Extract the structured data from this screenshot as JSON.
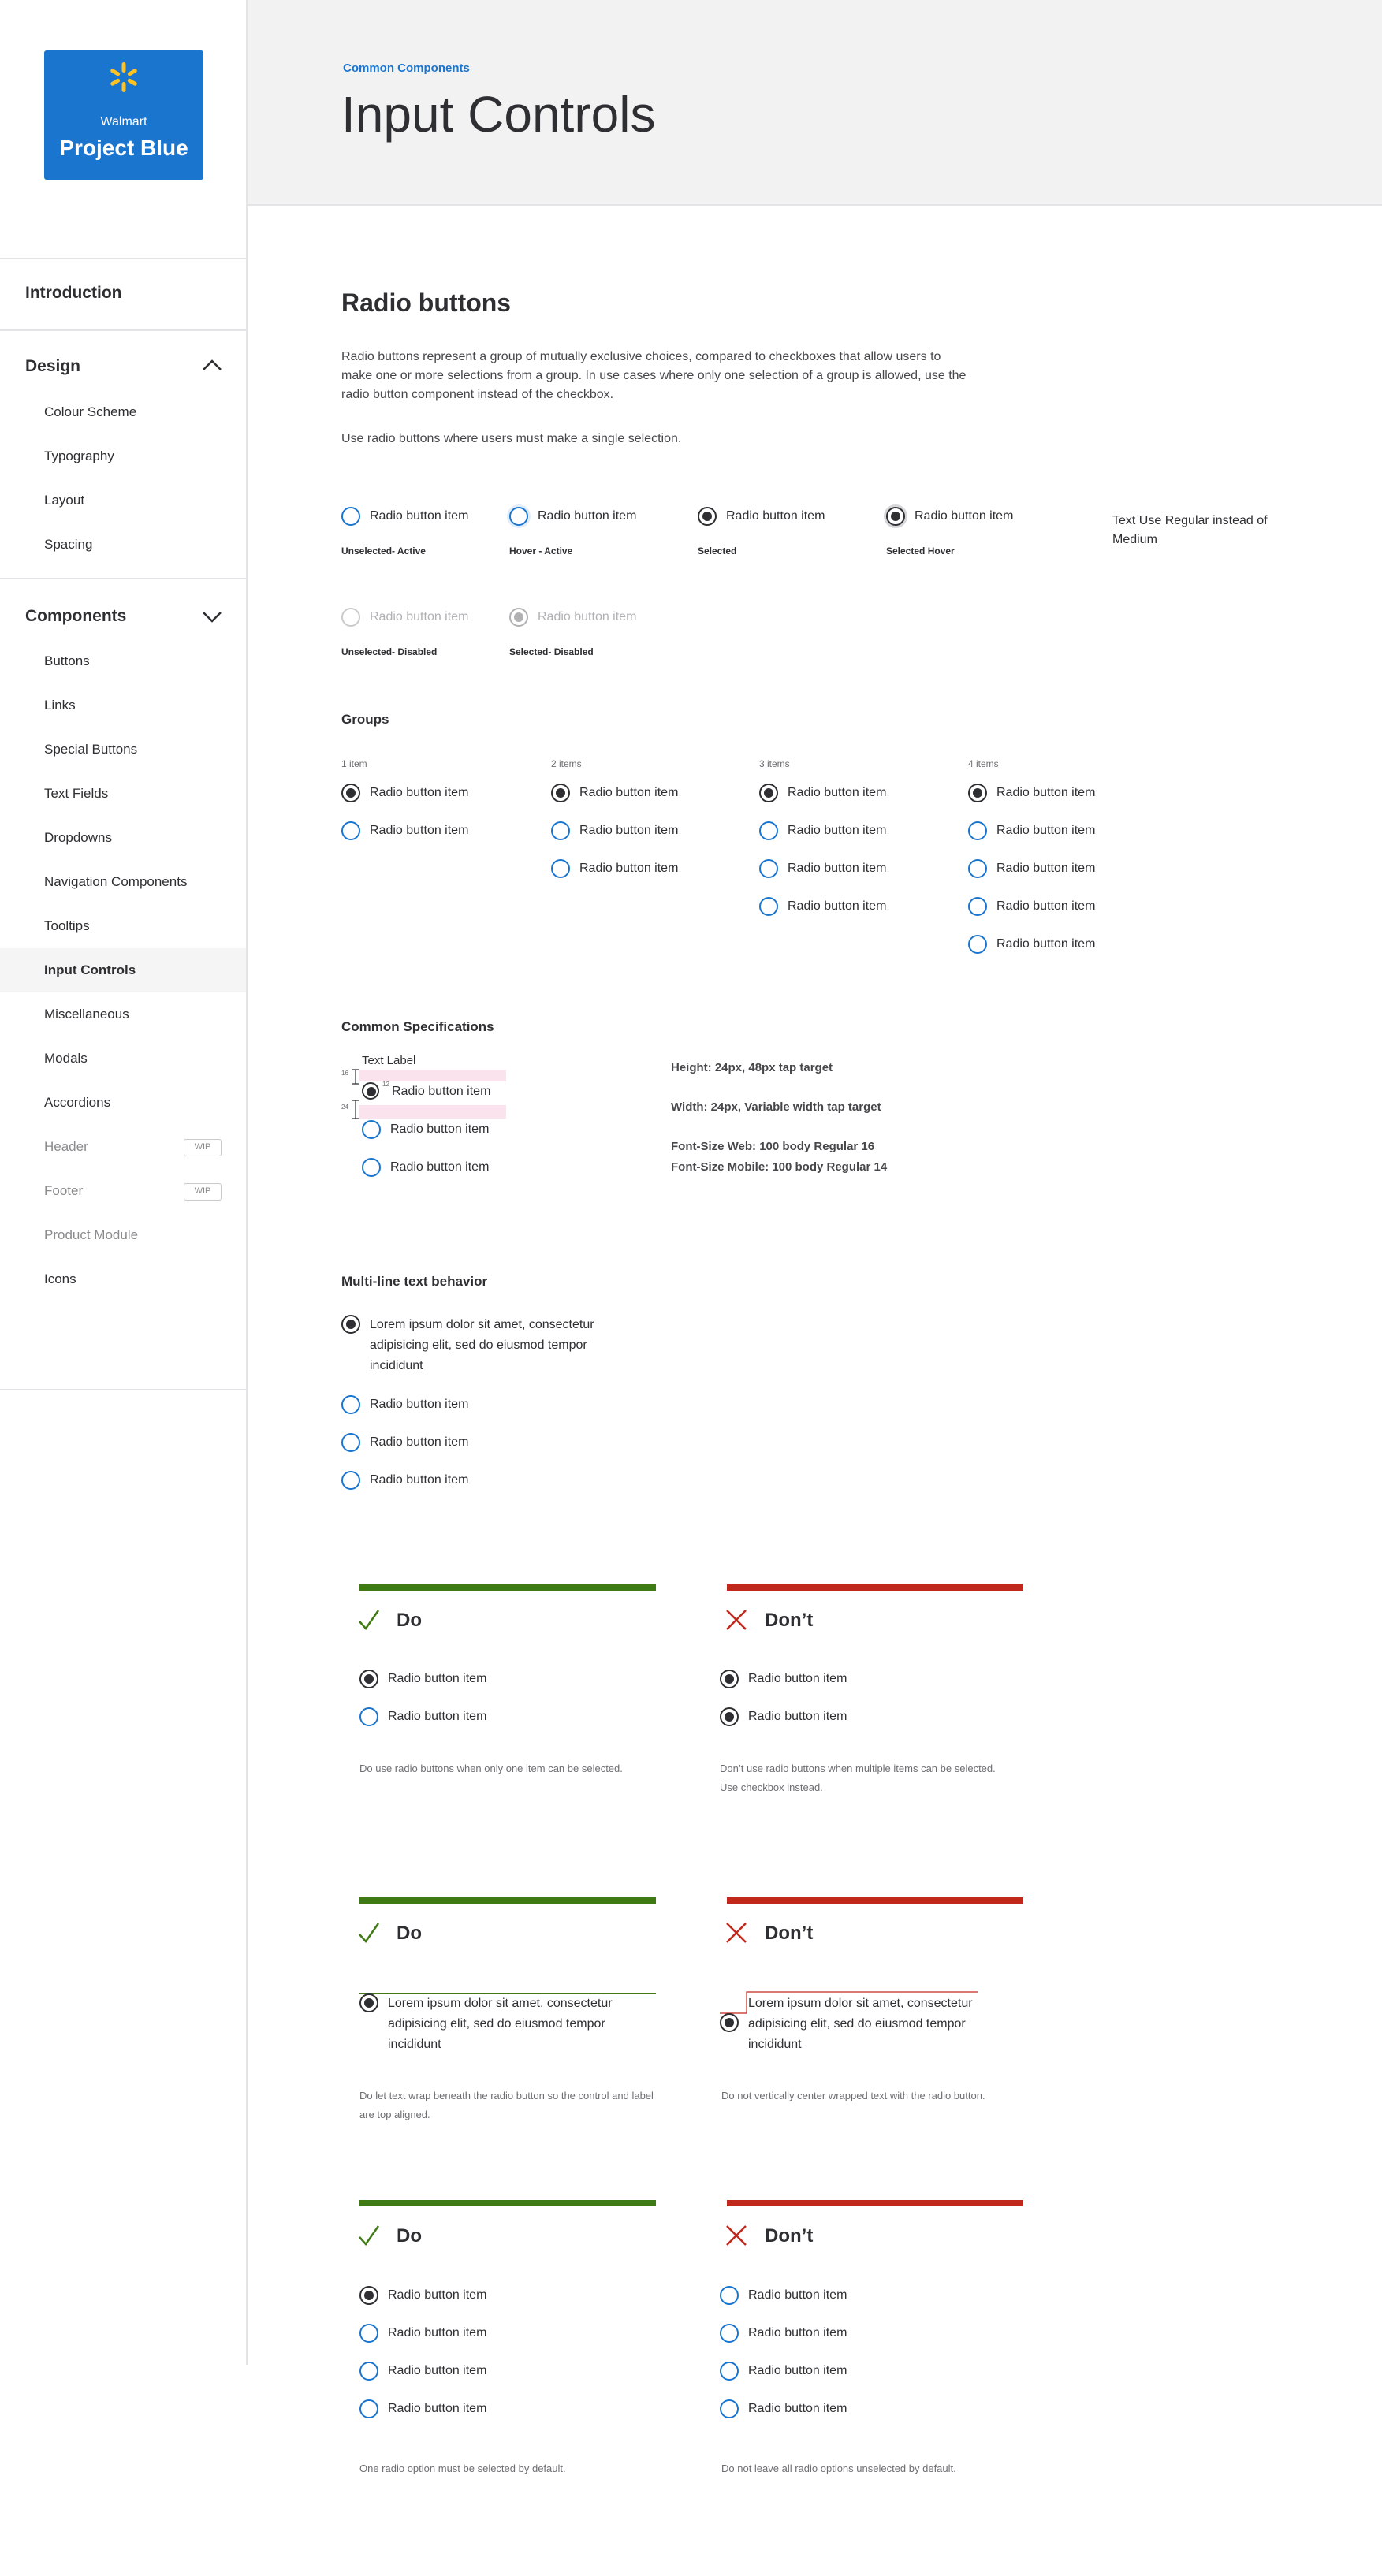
{
  "brand": {
    "sub": "Walmart",
    "title": "Project Blue",
    "spark_color": "#ffc220",
    "bg": "#1a75cf"
  },
  "sidebar": {
    "introduction": "Introduction",
    "design": {
      "label": "Design",
      "items": [
        "Colour Scheme",
        "Typography",
        "Layout",
        "Spacing"
      ]
    },
    "components": {
      "label": "Components",
      "items": [
        "Buttons",
        "Links",
        "Special Buttons",
        "Text Fields",
        "Dropdowns",
        "Navigation Components",
        "Tooltips",
        "Input Controls",
        "Miscellaneous",
        "Modals",
        "Accordions",
        "Header",
        "Footer",
        "Product Module",
        "Icons"
      ],
      "active": "Input Controls",
      "wip_badge": "WIP"
    }
  },
  "header": {
    "breadcrumb": "Common Components",
    "title": "Input Controls"
  },
  "section": {
    "title": "Radio buttons",
    "intro": "Radio buttons represent a group of mutually exclusive choices, compared to checkboxes that allow users to make one or more selections from a group. In use cases where only one selection of a group is allowed, use the radio button component instead of the checkbox.",
    "usage": "Use radio buttons where users must make a single selection."
  },
  "radio_label": "Radio button item",
  "states": {
    "unselected_active": "Unselected- Active",
    "hover_active": "Hover - Active",
    "selected": "Selected",
    "selected_hover": "Selected Hover",
    "unselected_disabled": "Unselected- Disabled",
    "selected_disabled": "Selected- Disabled",
    "note": "Text Use Regular instead of Medium"
  },
  "groups": {
    "title": "Groups",
    "labels": [
      "1 item",
      "2 items",
      "3 items",
      "4 items"
    ]
  },
  "specs": {
    "title": "Common Specifications",
    "text_label": "Text Label",
    "dim_16": "16",
    "dim_12": "12",
    "dim_24": "24",
    "height": "Height: 24px, 48px tap target",
    "width": "Width: 24px, Variable width tap target",
    "font_web": "Font-Size Web: 100 body Regular 16",
    "font_mobile": "Font-Size Mobile: 100 body Regular 14"
  },
  "multiline": {
    "title": "Multi-line text behavior",
    "long_label": "Lorem ipsum dolor sit amet, consectetur adipisicing elit, sed do eiusmod tempor incididunt"
  },
  "do_dont": {
    "do": "Do",
    "dont": "Don’t",
    "do_color": "#3f7a14",
    "dont_color": "#c1281c",
    "notes": [
      "Do use radio buttons when only one item can be selected.",
      "Don’t use radio buttons when multiple items can be selected. Use checkbox instead.",
      "Do let text wrap beneath the radio button so the control and label are top aligned.",
      "Do not vertically center wrapped text with the radio button.",
      "One radio option must be selected by default.",
      "Do not leave all radio options unselected by default."
    ]
  }
}
